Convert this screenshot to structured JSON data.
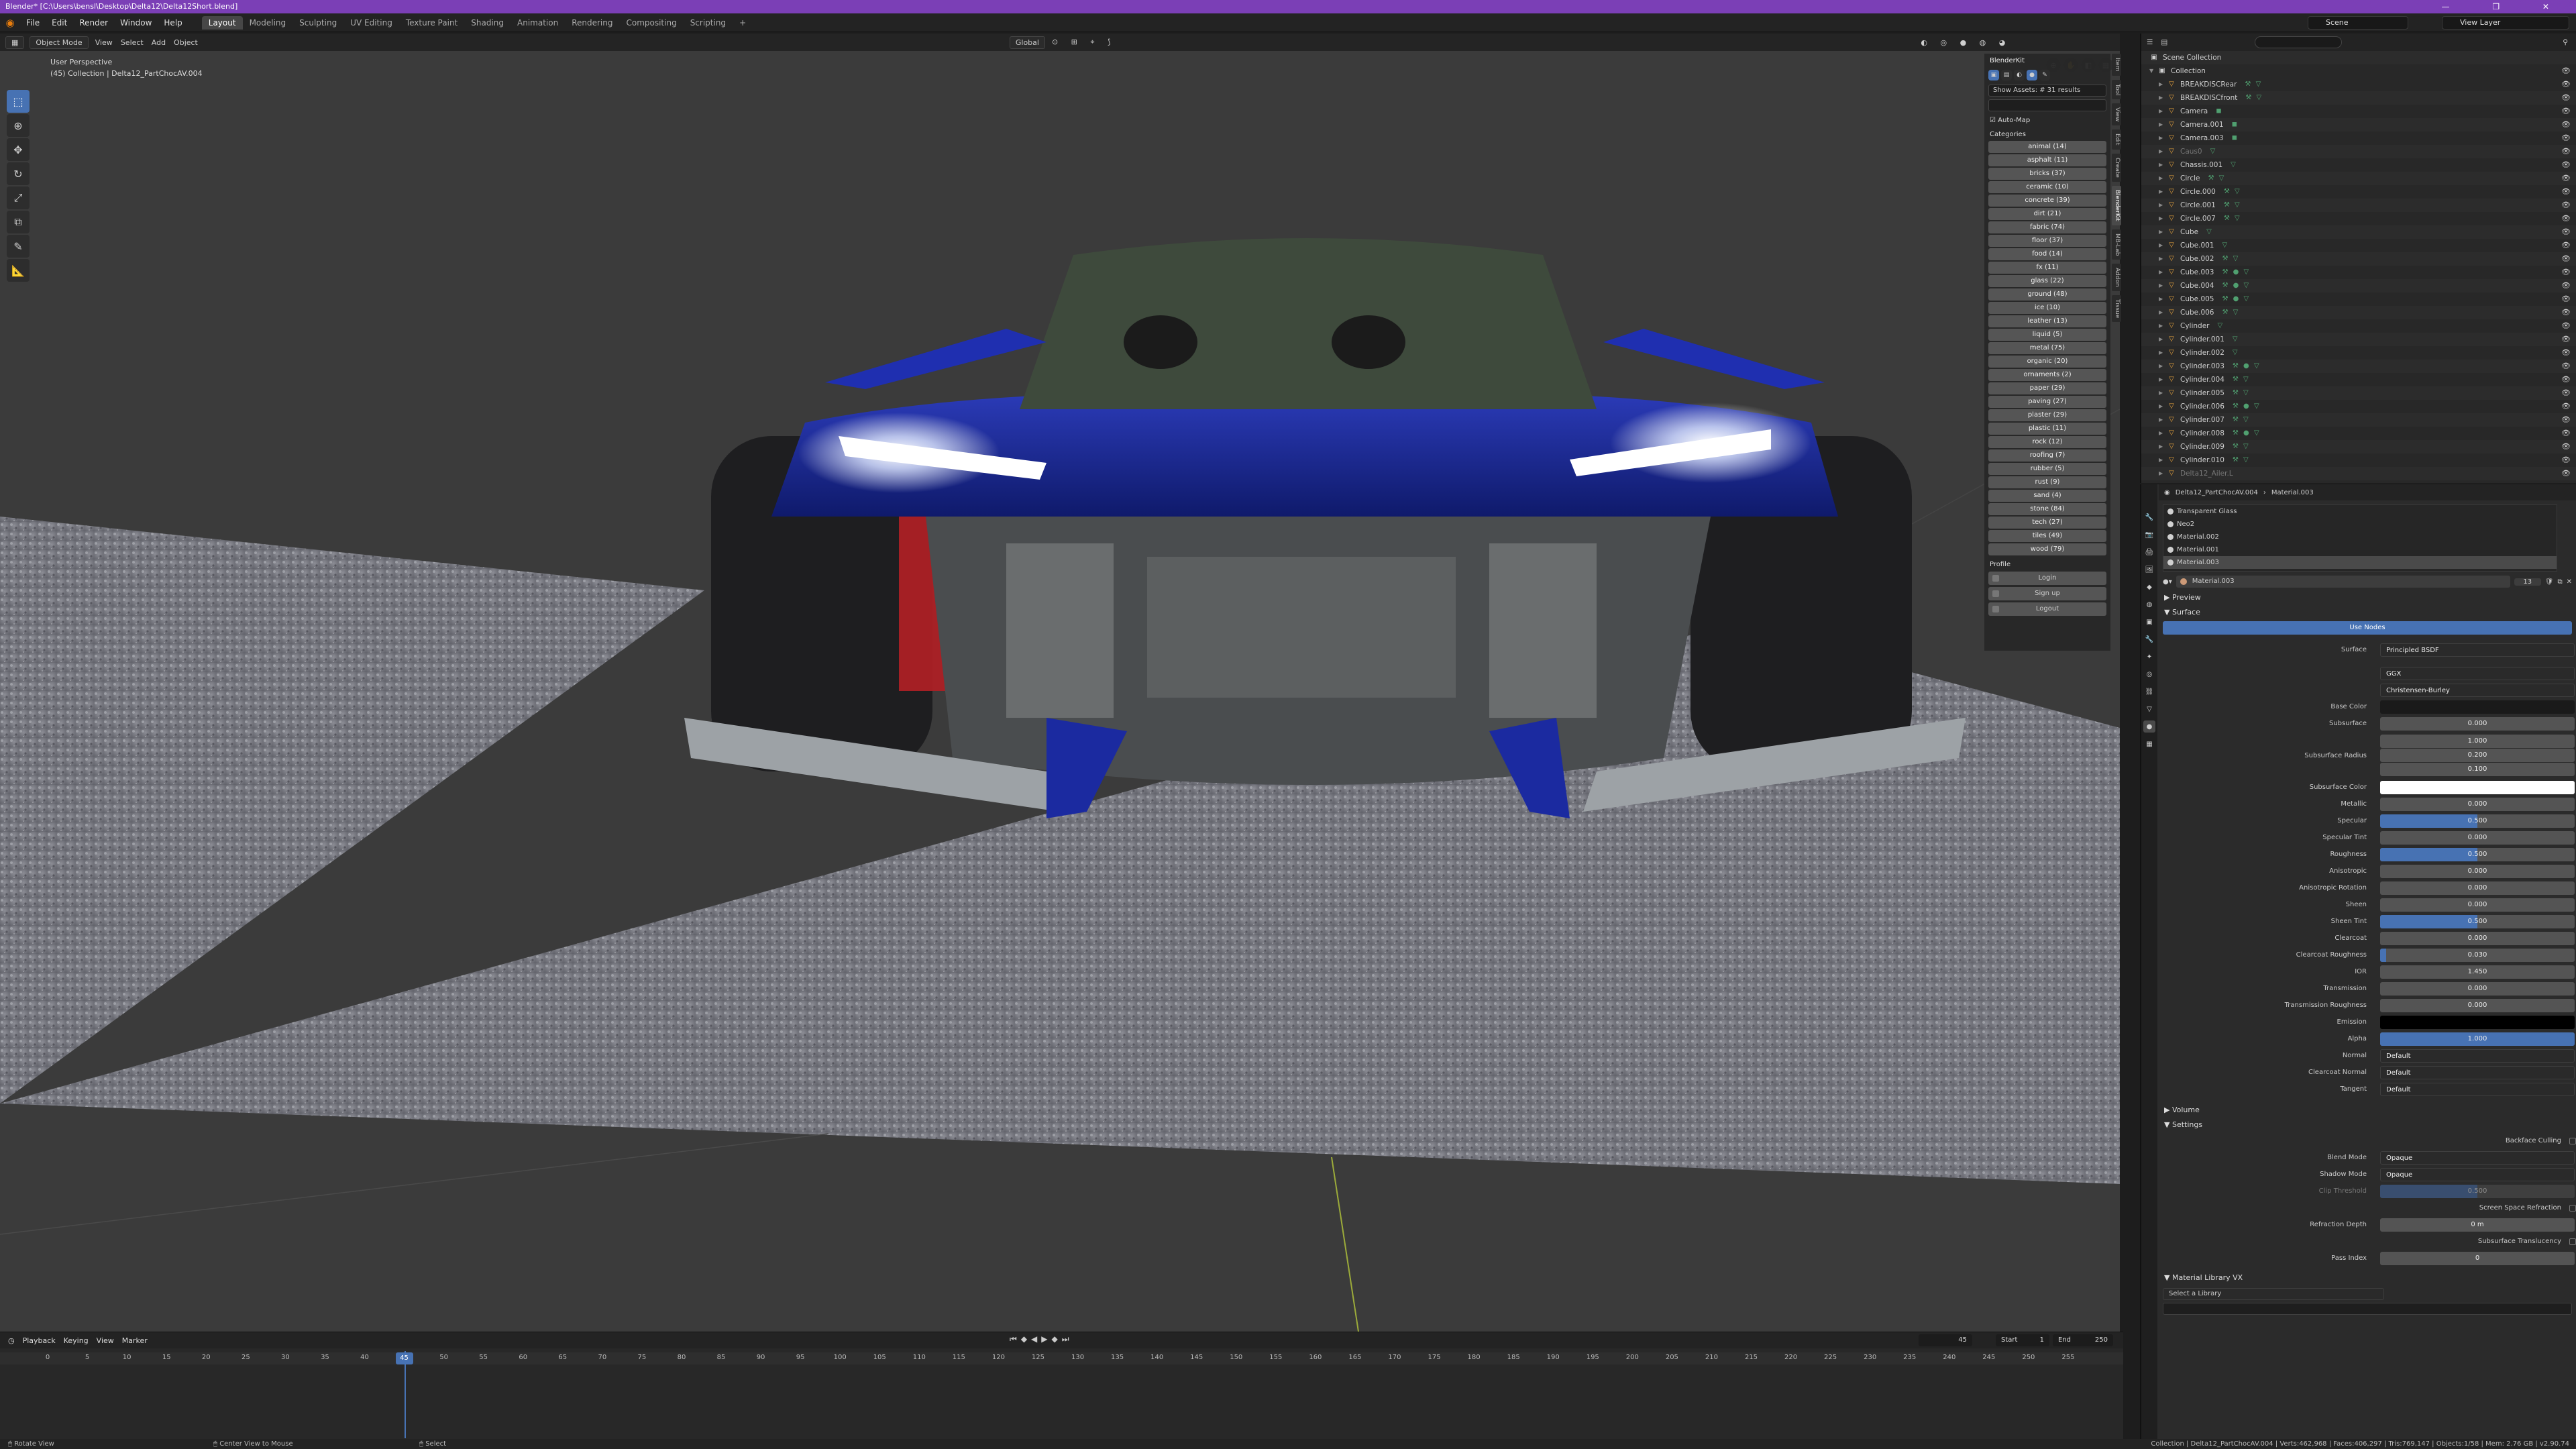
{
  "window": {
    "title": "Blender* [C:\\Users\\bensl\\Desktop\\Delta12\\Delta12Short.blend]"
  },
  "menus": [
    "File",
    "Edit",
    "Render",
    "Window",
    "Help"
  ],
  "workspaces": [
    "Layout",
    "Modeling",
    "Sculpting",
    "UV Editing",
    "Texture Paint",
    "Shading",
    "Animation",
    "Rendering",
    "Compositing",
    "Scripting"
  ],
  "active_workspace": "Layout",
  "top_right": {
    "scene_label": "Scene",
    "view_layer_label": "View Layer"
  },
  "viewport": {
    "mode": "Object Mode",
    "header_menus": [
      "View",
      "Select",
      "Add",
      "Object"
    ],
    "orientation": "Global",
    "perspective": "User Perspective",
    "collection_info": "(45) Collection | Delta12_PartChocAV.004"
  },
  "blenderkit": {
    "title": "BlenderKit",
    "search_text": "Show Assets: # 31 results",
    "auto_map": "Auto-Map",
    "categories_label": "Categories",
    "categories": [
      "animal (14)",
      "asphalt (11)",
      "bricks (37)",
      "ceramic (10)",
      "concrete (39)",
      "dirt (21)",
      "fabric (74)",
      "floor (37)",
      "food (14)",
      "fx (11)",
      "glass (22)",
      "ground (48)",
      "ice (10)",
      "leather (13)",
      "liquid (5)",
      "metal (75)",
      "organic (20)",
      "ornaments (2)",
      "paper (29)",
      "paving (27)",
      "plaster (29)",
      "plastic (11)",
      "rock (12)",
      "roofing (7)",
      "rubber (5)",
      "rust (9)",
      "sand (4)",
      "stone (84)",
      "tech (27)",
      "tiles (49)",
      "wood (79)"
    ],
    "profile_label": "Profile",
    "buttons": [
      "Login",
      "Sign up",
      "Logout"
    ]
  },
  "side_tabs": [
    "Item",
    "Tool",
    "View",
    "Edit",
    "Create",
    "BlenderKit",
    "MB-Lab",
    "Addon",
    "Tissue"
  ],
  "timeline": {
    "menus": [
      "Playback",
      "Keying",
      "View",
      "Marker"
    ],
    "current_frame": "45",
    "start_label": "Start",
    "start": "1",
    "end_label": "End",
    "end": "250",
    "ticks": [
      "0",
      "5",
      "10",
      "15",
      "20",
      "25",
      "30",
      "35",
      "40",
      "45",
      "50",
      "55",
      "60",
      "65",
      "70",
      "75",
      "80",
      "85",
      "90",
      "95",
      "100",
      "105",
      "110",
      "115",
      "120",
      "125",
      "130",
      "135",
      "140",
      "145",
      "150",
      "155",
      "160",
      "165",
      "170",
      "175",
      "180",
      "185",
      "190",
      "195",
      "200",
      "205",
      "210",
      "215",
      "220",
      "225",
      "230",
      "235",
      "240",
      "245",
      "250",
      "255"
    ]
  },
  "statusbar": {
    "hints": [
      "Rotate View",
      "Center View to Mouse",
      "Select"
    ],
    "stats": "Collection | Delta12_PartChocAV.004 | Verts:462,968 | Faces:406,297 | Tris:769,147 | Objects:1/58 | Mem: 2.76 GB | v2.90.74"
  },
  "outliner": {
    "root": "Scene Collection",
    "collection": "Collection",
    "items": [
      {
        "name": "BREAKDISCRear",
        "mods": "⚒ ▽"
      },
      {
        "name": "BREAKDISCfront",
        "mods": "⚒ ▽"
      },
      {
        "name": "Camera",
        "mods": "◼"
      },
      {
        "name": "Camera.001",
        "mods": "◼"
      },
      {
        "name": "Camera.003",
        "mods": "◼"
      },
      {
        "name": "Caus0",
        "mods": "▽",
        "dim": true
      },
      {
        "name": "Chassis.001",
        "mods": "▽"
      },
      {
        "name": "Circle",
        "mods": "⚒ ▽"
      },
      {
        "name": "Circle.000",
        "mods": "⚒ ▽"
      },
      {
        "name": "Circle.001",
        "mods": "⚒ ▽"
      },
      {
        "name": "Circle.007",
        "mods": "⚒ ▽"
      },
      {
        "name": "Cube",
        "mods": "▽"
      },
      {
        "name": "Cube.001",
        "mods": "▽"
      },
      {
        "name": "Cube.002",
        "mods": "⚒ ▽"
      },
      {
        "name": "Cube.003",
        "mods": "⚒ ● ▽"
      },
      {
        "name": "Cube.004",
        "mods": "⚒ ● ▽"
      },
      {
        "name": "Cube.005",
        "mods": "⚒ ● ▽"
      },
      {
        "name": "Cube.006",
        "mods": "⚒ ▽"
      },
      {
        "name": "Cylinder",
        "mods": "▽"
      },
      {
        "name": "Cylinder.001",
        "mods": "▽"
      },
      {
        "name": "Cylinder.002",
        "mods": "▽"
      },
      {
        "name": "Cylinder.003",
        "mods": "⚒ ● ▽"
      },
      {
        "name": "Cylinder.004",
        "mods": "⚒ ▽"
      },
      {
        "name": "Cylinder.005",
        "mods": "⚒ ▽"
      },
      {
        "name": "Cylinder.006",
        "mods": "⚒ ● ▽"
      },
      {
        "name": "Cylinder.007",
        "mods": "⚒ ▽"
      },
      {
        "name": "Cylinder.008",
        "mods": "⚒ ● ▽"
      },
      {
        "name": "Cylinder.009",
        "mods": "⚒ ▽"
      },
      {
        "name": "Cylinder.010",
        "mods": "⚒ ▽"
      },
      {
        "name": "Delta12_Ailer.L",
        "mods": "",
        "dim": true
      }
    ]
  },
  "properties": {
    "header_object": "Delta12_PartChocAV.004",
    "header_material": "Material.003",
    "slots": [
      "Transparent Glass",
      "Neo2",
      "Material.002",
      "Material.001",
      "Material.003"
    ],
    "active_slot": "Material.003",
    "material_name": "Material.003",
    "material_users": "13",
    "preview_label": "Preview",
    "surface_panel": "Surface",
    "use_nodes": "Use Nodes",
    "surface_label": "Surface",
    "surface_shader": "Principled BSDF",
    "distribution": "GGX",
    "subsurface_method": "Christensen-Burley",
    "rows": [
      {
        "label": "Base Color",
        "value": "",
        "kind": "color-dark"
      },
      {
        "label": "Subsurface",
        "value": "0.000",
        "fill": 0
      },
      {
        "label": "Subsurface Radius",
        "values": [
          "1.000",
          "0.200",
          "0.100"
        ],
        "kind": "multi"
      },
      {
        "label": "Subsurface Color",
        "value": "",
        "kind": "color"
      },
      {
        "label": "Metallic",
        "value": "0.000",
        "fill": 0
      },
      {
        "label": "Specular",
        "value": "0.500",
        "fill": 0.5
      },
      {
        "label": "Specular Tint",
        "value": "0.000",
        "fill": 0
      },
      {
        "label": "Roughness",
        "value": "0.500",
        "fill": 0.5
      },
      {
        "label": "Anisotropic",
        "value": "0.000",
        "fill": 0
      },
      {
        "label": "Anisotropic Rotation",
        "value": "0.000",
        "fill": 0
      },
      {
        "label": "Sheen",
        "value": "0.000",
        "fill": 0
      },
      {
        "label": "Sheen Tint",
        "value": "0.500",
        "fill": 0.5
      },
      {
        "label": "Clearcoat",
        "value": "0.000",
        "fill": 0
      },
      {
        "label": "Clearcoat Roughness",
        "value": "0.030",
        "fill": 0.03
      },
      {
        "label": "IOR",
        "value": "1.450",
        "fill": 0
      },
      {
        "label": "Transmission",
        "value": "0.000",
        "fill": 0
      },
      {
        "label": "Transmission Roughness",
        "value": "0.000",
        "fill": 0
      },
      {
        "label": "Emission",
        "value": "",
        "kind": "black"
      },
      {
        "label": "Alpha",
        "value": "1.000",
        "fill": 1
      },
      {
        "label": "Normal",
        "value": "Default",
        "kind": "menu"
      },
      {
        "label": "Clearcoat Normal",
        "value": "Default",
        "kind": "menu"
      },
      {
        "label": "Tangent",
        "value": "Default",
        "kind": "menu"
      }
    ],
    "volume_panel": "Volume",
    "settings_panel": "Settings",
    "backface_culling": "Backface Culling",
    "blend_mode_label": "Blend Mode",
    "blend_mode": "Opaque",
    "shadow_mode_label": "Shadow Mode",
    "shadow_mode": "Opaque",
    "clip_threshold_label": "Clip Threshold",
    "clip_threshold": "0.500",
    "ssr_label": "Screen Space Refraction",
    "refraction_depth_label": "Refraction Depth",
    "refraction_depth": "0 m",
    "sss_translucency_label": "Subsurface Translucency",
    "pass_index_label": "Pass Index",
    "pass_index": "0",
    "library_panel": "Material Library VX",
    "library_select": "Select a Library"
  },
  "colors": {
    "accent": "#4772b3",
    "title_bar": "#7b3fb6",
    "car_body": "#1a2a9a",
    "headlight": "#ffffff"
  }
}
